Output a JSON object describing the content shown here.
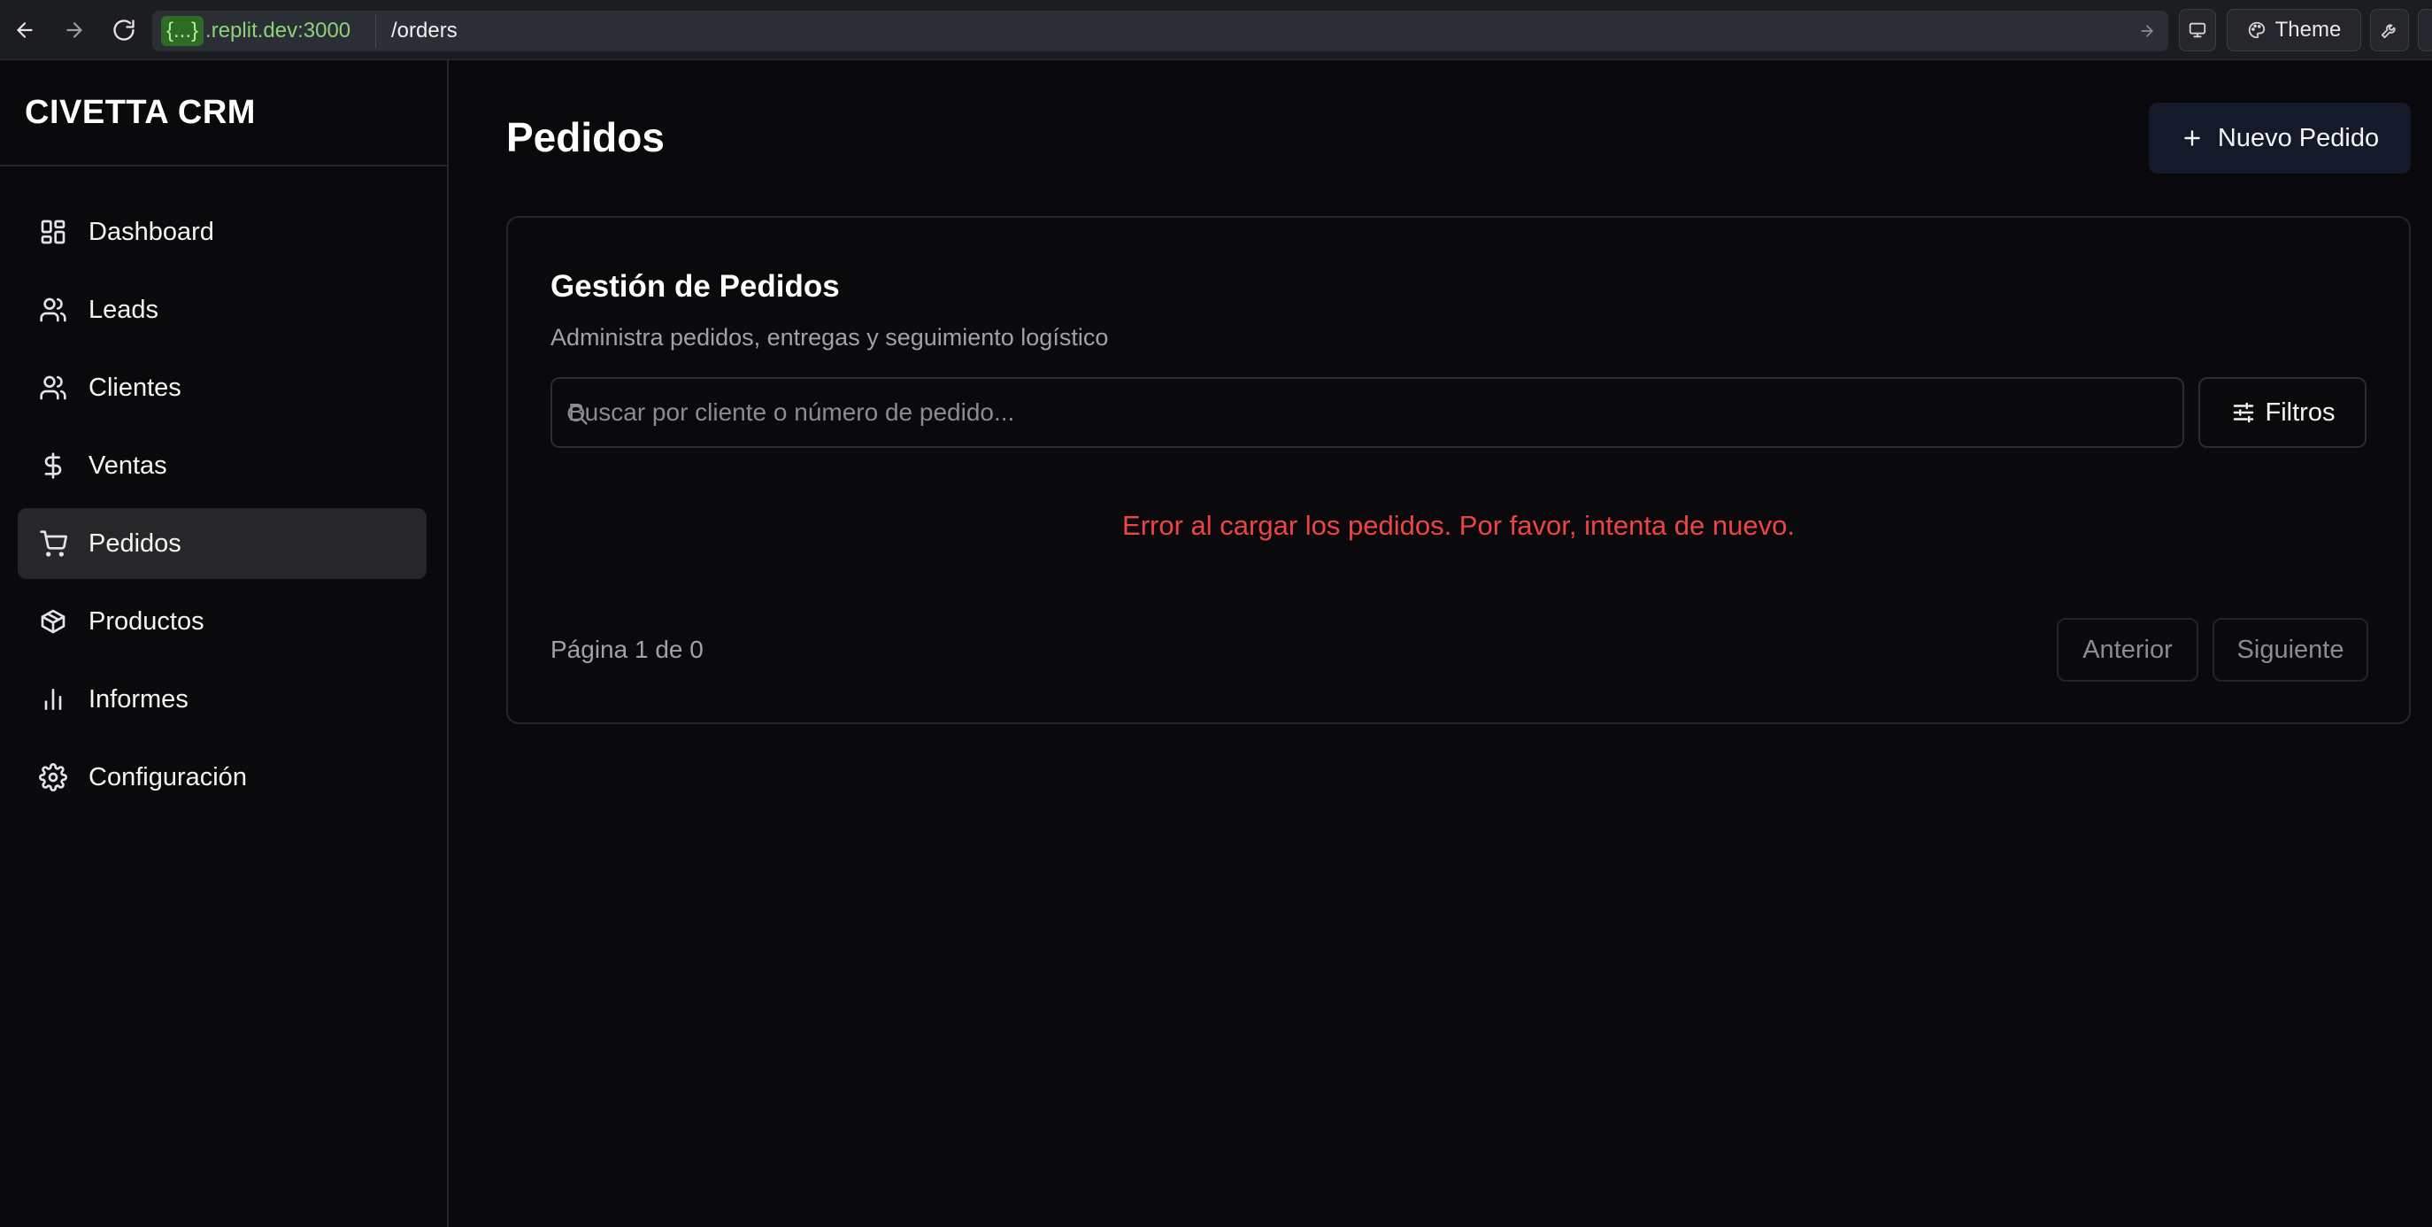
{
  "browser": {
    "url_host_prefix": "{...}",
    "url_host": ".replit.dev:3000",
    "url_path": "/orders",
    "theme_label": "Theme"
  },
  "sidebar": {
    "brand": "CIVETTA CRM",
    "items": [
      {
        "label": "Dashboard",
        "icon": "layout-dashboard-icon"
      },
      {
        "label": "Leads",
        "icon": "users-icon"
      },
      {
        "label": "Clientes",
        "icon": "users-icon"
      },
      {
        "label": "Ventas",
        "icon": "dollar-sign-icon"
      },
      {
        "label": "Pedidos",
        "icon": "shopping-cart-icon",
        "active": true
      },
      {
        "label": "Productos",
        "icon": "package-icon"
      },
      {
        "label": "Informes",
        "icon": "bar-chart-icon"
      },
      {
        "label": "Configuración",
        "icon": "settings-icon"
      }
    ]
  },
  "main": {
    "title": "Pedidos",
    "new_button": "Nuevo Pedido",
    "card": {
      "title": "Gestión de Pedidos",
      "subtitle": "Administra pedidos, entregas y seguimiento logístico",
      "search_placeholder": "Buscar por cliente o número de pedido...",
      "search_value": "",
      "filters_label": "Filtros",
      "error": "Error al cargar los pedidos. Por favor, intenta de nuevo.",
      "pagination": {
        "info": "Página 1 de 0",
        "prev": "Anterior",
        "next": "Siguiente"
      }
    }
  },
  "colors": {
    "background": "#0a0a0c",
    "active_nav": "#27272a",
    "primary_button": "#141a2a",
    "error": "#ef4444",
    "muted_text": "#a1a1aa"
  }
}
